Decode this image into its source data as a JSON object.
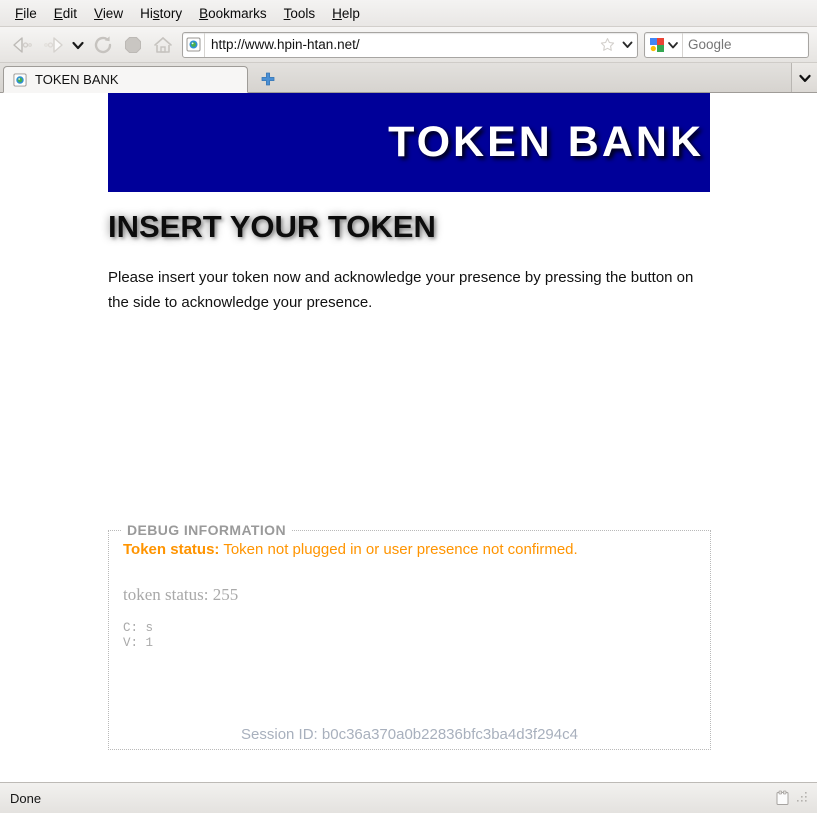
{
  "browser": {
    "menu": [
      {
        "label": "File",
        "access_key": "F"
      },
      {
        "label": "Edit",
        "access_key": "E"
      },
      {
        "label": "View",
        "access_key": "V"
      },
      {
        "label": "History",
        "access_key": "s"
      },
      {
        "label": "Bookmarks",
        "access_key": "B"
      },
      {
        "label": "Tools",
        "access_key": "T"
      },
      {
        "label": "Help",
        "access_key": "H"
      }
    ],
    "toolbar": {
      "back_icon": "back-arrow-icon",
      "forward_icon": "forward-arrow-icon",
      "history_dropdown_icon": "chevron-down-icon",
      "reload_icon": "reload-icon",
      "stop_icon": "stop-icon",
      "home_icon": "home-icon"
    },
    "url_bar": {
      "value": "http://www.hpin-htan.net/",
      "favicon": "page-globe-icon",
      "bookmark_icon": "star-icon",
      "dropdown_icon": "chevron-down-icon"
    },
    "search_bar": {
      "engine": "Google",
      "engine_icon": "google-icon",
      "placeholder": "Google",
      "value": "",
      "go_icon": "magnifier-icon",
      "dropdown_icon": "chevron-down-icon"
    },
    "tabs": [
      {
        "label": "TOKEN BANK",
        "favicon": "page-globe-icon",
        "active": true
      }
    ],
    "new_tab_label": "+",
    "tab_list_icon": "chevron-down-icon",
    "status": {
      "text": "Done",
      "icon": "window-notes-icon",
      "grip": "resize-grip-icon"
    }
  },
  "page": {
    "banner_title": "TOKEN BANK",
    "banner_color": "#000099",
    "heading": "INSERT YOUR TOKEN",
    "paragraph": "Please insert your token now and acknowledge your presence by pressing the button on the side to acknowledge your presence.",
    "debug": {
      "legend": "DEBUG INFORMATION",
      "status_label": "Token status:",
      "status_message": "Token not plugged in or user presence not confirmed.",
      "status_color": "#ff9400",
      "raw_status": "token status: 255",
      "mono_line_1": "C: s",
      "mono_line_2": "V: 1",
      "session_label": "Session ID:",
      "session_id": "b0c36a370a0b22836bfc3ba4d3f294c4",
      "session_full": "Session ID: b0c36a370a0b22836bfc3ba4d3f294c4"
    }
  }
}
